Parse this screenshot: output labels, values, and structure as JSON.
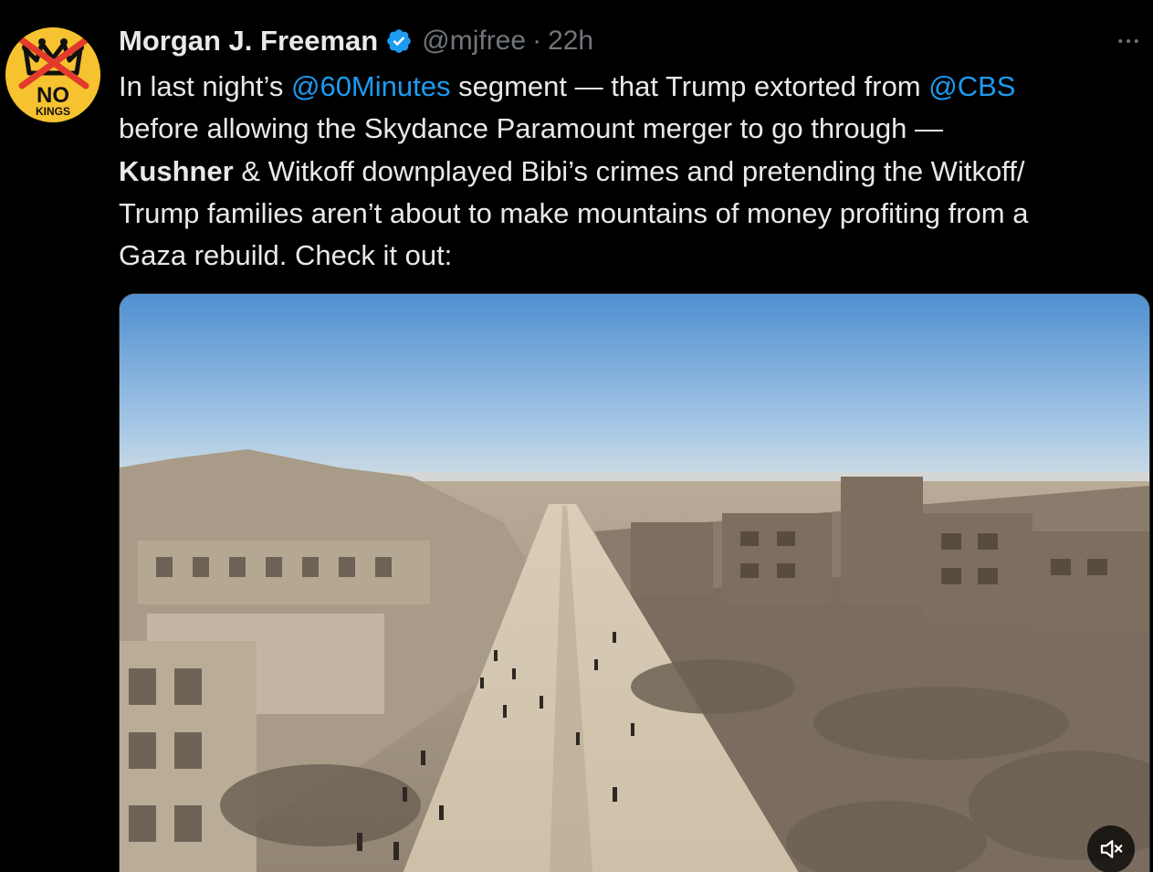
{
  "avatar": {
    "label_no": "NO",
    "label_kings": "KINGS",
    "background": "#f6c22f"
  },
  "author": {
    "display_name": "Morgan J. Freeman",
    "handle": "@mjfree",
    "separator": "·",
    "time": "22h",
    "verified_icon": "verified-badge-icon"
  },
  "tweet": {
    "lines": [
      [
        "In last night’s ",
        "@60Minutes",
        " segment — that Trump extorted from ",
        "@CBS"
      ],
      [
        "before allowing the Skydance Paramount merger to go through —"
      ],
      [
        "Kushner",
        " & Witkoff downplayed Bibi’s crimes and pretending the Witkoff/"
      ],
      [
        "Trump families aren’t about to make mountains of money profiting from a"
      ],
      [
        "Gaza rebuild. Check it out:"
      ]
    ]
  },
  "media": {
    "type": "video",
    "mute_icon": "muted-speaker-icon"
  },
  "colors": {
    "background": "#000000",
    "text": "#e7e9ea",
    "secondary": "#71767b",
    "link": "#1d9bf0"
  }
}
